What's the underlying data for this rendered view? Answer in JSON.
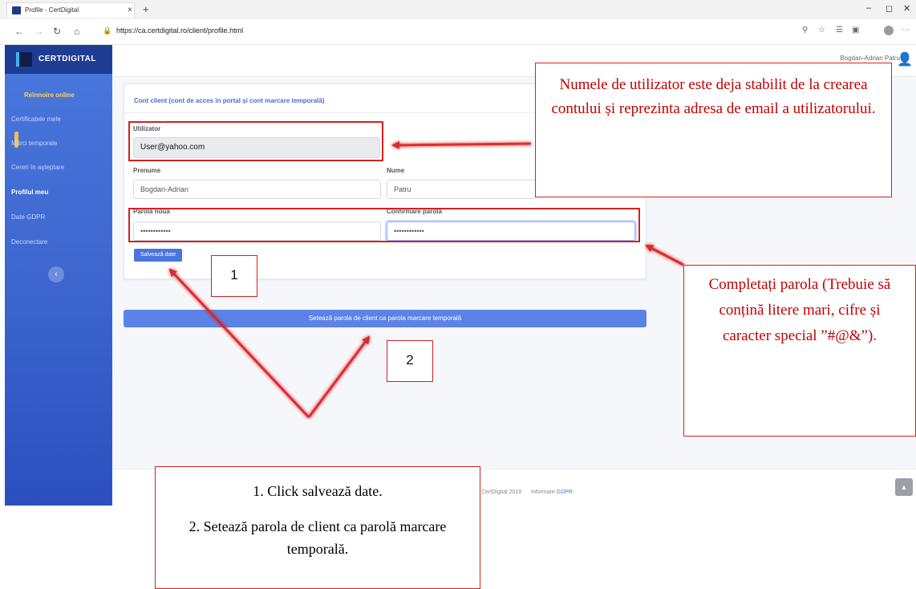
{
  "browser": {
    "tab_title": "Profile - CertDigital",
    "tab_close": "×",
    "new_tab": "+",
    "url": "https://ca.certdigital.ro/client/profile.html",
    "win_min": "–",
    "win_max": "◻",
    "win_close": "✕"
  },
  "brand": {
    "name": "CERTDIGITAL"
  },
  "header": {
    "user_name": "Bogdan-Adrian Patru"
  },
  "sidebar": {
    "items": [
      {
        "label": "Reînnoire online"
      },
      {
        "label": "Certificatele mele"
      },
      {
        "label": "Mărci temporale"
      },
      {
        "label": "Cereri în așteptare"
      },
      {
        "label": "Profilul meu"
      },
      {
        "label": "Date GDPR"
      },
      {
        "label": "Deconectare"
      }
    ],
    "collapse_icon": "‹"
  },
  "card": {
    "title": "Cont client (cont de acces în portal și cont marcare temporală)",
    "user_label": "Utilizator",
    "user_value": "User@yahoo.com",
    "firstname_label": "Prenume",
    "firstname_value": "Bogdan-Adrian",
    "lastname_label": "Nume",
    "lastname_value": "Patru",
    "newpass_label": "Parolă nouă",
    "newpass_value": "••••••••••••",
    "confirm_label": "Confirmare parolă",
    "confirm_value": "••••••••••••",
    "save_button": "Salvează date"
  },
  "wide_button": "Setează parola de client ca parola marcare temporală",
  "footer": {
    "copyright": "CertDigital 2019",
    "info": "Informare",
    "gdpr_link": "GDPR",
    "scroll_top": "▲"
  },
  "annotations": {
    "callout_user": "Numele de utilizator este deja stabilit de la crearea contului și reprezinta adresa de email a utilizatorului.",
    "callout_password": "Completați parola (Trebuie să conțină litere mari, cifre și caracter special ”#@&”).",
    "callout_steps_1": "1. Click salvează date.",
    "callout_steps_2": "2. Setează parola de client ca parolă marcare temporală.",
    "num_1": "1",
    "num_2": "2"
  },
  "colors": {
    "annotation_red": "#d42020",
    "callout_text_red": "#c00000",
    "sidebar_blue": "#3d67cf",
    "accent_blue": "#4a74e0"
  }
}
